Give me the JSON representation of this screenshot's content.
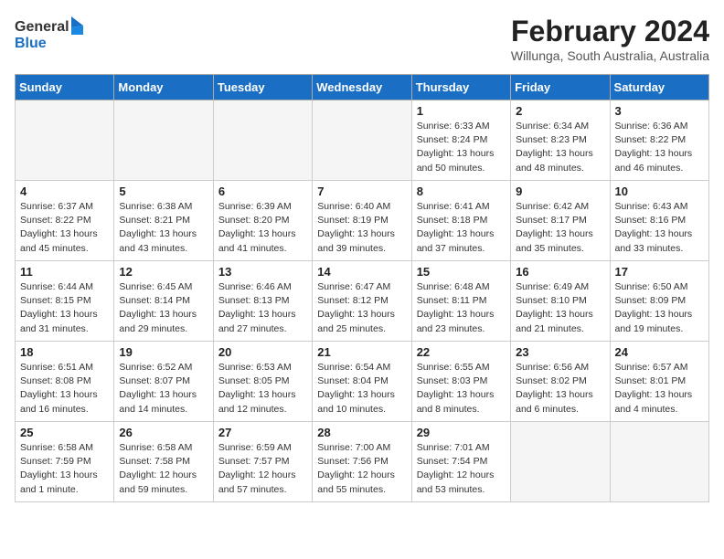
{
  "header": {
    "logo_general": "General",
    "logo_blue": "Blue",
    "month_year": "February 2024",
    "location": "Willunga, South Australia, Australia"
  },
  "days_of_week": [
    "Sunday",
    "Monday",
    "Tuesday",
    "Wednesday",
    "Thursday",
    "Friday",
    "Saturday"
  ],
  "weeks": [
    [
      {
        "day": "",
        "info": ""
      },
      {
        "day": "",
        "info": ""
      },
      {
        "day": "",
        "info": ""
      },
      {
        "day": "",
        "info": ""
      },
      {
        "day": "1",
        "info": "Sunrise: 6:33 AM\nSunset: 8:24 PM\nDaylight: 13 hours\nand 50 minutes."
      },
      {
        "day": "2",
        "info": "Sunrise: 6:34 AM\nSunset: 8:23 PM\nDaylight: 13 hours\nand 48 minutes."
      },
      {
        "day": "3",
        "info": "Sunrise: 6:36 AM\nSunset: 8:22 PM\nDaylight: 13 hours\nand 46 minutes."
      }
    ],
    [
      {
        "day": "4",
        "info": "Sunrise: 6:37 AM\nSunset: 8:22 PM\nDaylight: 13 hours\nand 45 minutes."
      },
      {
        "day": "5",
        "info": "Sunrise: 6:38 AM\nSunset: 8:21 PM\nDaylight: 13 hours\nand 43 minutes."
      },
      {
        "day": "6",
        "info": "Sunrise: 6:39 AM\nSunset: 8:20 PM\nDaylight: 13 hours\nand 41 minutes."
      },
      {
        "day": "7",
        "info": "Sunrise: 6:40 AM\nSunset: 8:19 PM\nDaylight: 13 hours\nand 39 minutes."
      },
      {
        "day": "8",
        "info": "Sunrise: 6:41 AM\nSunset: 8:18 PM\nDaylight: 13 hours\nand 37 minutes."
      },
      {
        "day": "9",
        "info": "Sunrise: 6:42 AM\nSunset: 8:17 PM\nDaylight: 13 hours\nand 35 minutes."
      },
      {
        "day": "10",
        "info": "Sunrise: 6:43 AM\nSunset: 8:16 PM\nDaylight: 13 hours\nand 33 minutes."
      }
    ],
    [
      {
        "day": "11",
        "info": "Sunrise: 6:44 AM\nSunset: 8:15 PM\nDaylight: 13 hours\nand 31 minutes."
      },
      {
        "day": "12",
        "info": "Sunrise: 6:45 AM\nSunset: 8:14 PM\nDaylight: 13 hours\nand 29 minutes."
      },
      {
        "day": "13",
        "info": "Sunrise: 6:46 AM\nSunset: 8:13 PM\nDaylight: 13 hours\nand 27 minutes."
      },
      {
        "day": "14",
        "info": "Sunrise: 6:47 AM\nSunset: 8:12 PM\nDaylight: 13 hours\nand 25 minutes."
      },
      {
        "day": "15",
        "info": "Sunrise: 6:48 AM\nSunset: 8:11 PM\nDaylight: 13 hours\nand 23 minutes."
      },
      {
        "day": "16",
        "info": "Sunrise: 6:49 AM\nSunset: 8:10 PM\nDaylight: 13 hours\nand 21 minutes."
      },
      {
        "day": "17",
        "info": "Sunrise: 6:50 AM\nSunset: 8:09 PM\nDaylight: 13 hours\nand 19 minutes."
      }
    ],
    [
      {
        "day": "18",
        "info": "Sunrise: 6:51 AM\nSunset: 8:08 PM\nDaylight: 13 hours\nand 16 minutes."
      },
      {
        "day": "19",
        "info": "Sunrise: 6:52 AM\nSunset: 8:07 PM\nDaylight: 13 hours\nand 14 minutes."
      },
      {
        "day": "20",
        "info": "Sunrise: 6:53 AM\nSunset: 8:05 PM\nDaylight: 13 hours\nand 12 minutes."
      },
      {
        "day": "21",
        "info": "Sunrise: 6:54 AM\nSunset: 8:04 PM\nDaylight: 13 hours\nand 10 minutes."
      },
      {
        "day": "22",
        "info": "Sunrise: 6:55 AM\nSunset: 8:03 PM\nDaylight: 13 hours\nand 8 minutes."
      },
      {
        "day": "23",
        "info": "Sunrise: 6:56 AM\nSunset: 8:02 PM\nDaylight: 13 hours\nand 6 minutes."
      },
      {
        "day": "24",
        "info": "Sunrise: 6:57 AM\nSunset: 8:01 PM\nDaylight: 13 hours\nand 4 minutes."
      }
    ],
    [
      {
        "day": "25",
        "info": "Sunrise: 6:58 AM\nSunset: 7:59 PM\nDaylight: 13 hours\nand 1 minute."
      },
      {
        "day": "26",
        "info": "Sunrise: 6:58 AM\nSunset: 7:58 PM\nDaylight: 12 hours\nand 59 minutes."
      },
      {
        "day": "27",
        "info": "Sunrise: 6:59 AM\nSunset: 7:57 PM\nDaylight: 12 hours\nand 57 minutes."
      },
      {
        "day": "28",
        "info": "Sunrise: 7:00 AM\nSunset: 7:56 PM\nDaylight: 12 hours\nand 55 minutes."
      },
      {
        "day": "29",
        "info": "Sunrise: 7:01 AM\nSunset: 7:54 PM\nDaylight: 12 hours\nand 53 minutes."
      },
      {
        "day": "",
        "info": ""
      },
      {
        "day": "",
        "info": ""
      }
    ]
  ]
}
